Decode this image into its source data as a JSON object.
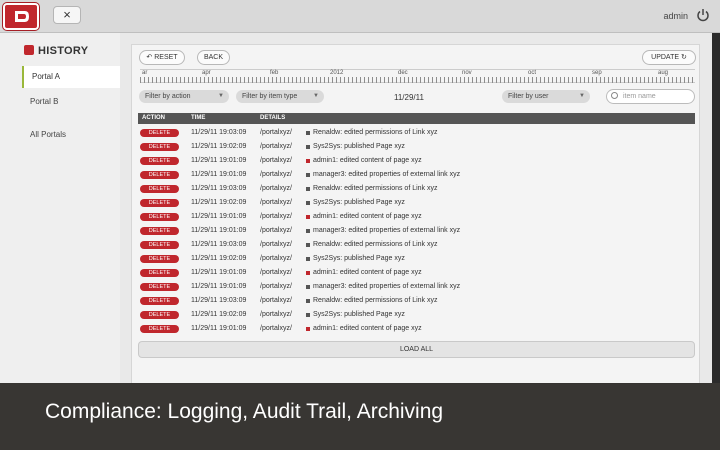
{
  "app": {
    "user": "admin",
    "close_label": "×"
  },
  "sidebar": {
    "title": "HISTORY",
    "items": [
      {
        "label": "Portal A",
        "active": true
      },
      {
        "label": "Portal B",
        "active": false
      },
      {
        "label": "All Portals",
        "active": false
      }
    ]
  },
  "toolbar": {
    "reset_label": "RESET",
    "back_label": "BACK",
    "update_label": "UPDATE"
  },
  "timeline": {
    "labels": [
      "ar",
      "apr",
      "feb",
      "2012",
      "dec",
      "nov",
      "oct",
      "sep",
      "aug"
    ]
  },
  "filters": {
    "action": "Filter by action",
    "item_type": "Filter by item type",
    "date": "11/29/11",
    "user": "Filter by user",
    "search_placeholder": "item name"
  },
  "table": {
    "headers": {
      "action": "ACTION",
      "time": "TIME",
      "details": "DETAILS"
    },
    "rows": [
      {
        "action": "DELETE",
        "time": "11/29/11 19:03:09",
        "site": "/portalxyz/",
        "details": "Renaldw: edited permissions of Link xyz",
        "color": "#555555"
      },
      {
        "action": "DELETE",
        "time": "11/29/11 19:02:09",
        "site": "/portalxyz/",
        "details": "Sys2Sys: published Page xyz",
        "color": "#555555"
      },
      {
        "action": "DELETE",
        "time": "11/29/11 19:01:09",
        "site": "/portalxyz/",
        "details": "admin1: edited content of page xyz",
        "color": "#c0272d"
      },
      {
        "action": "DELETE",
        "time": "11/29/11 19:01:09",
        "site": "/portalxyz/",
        "details": "manager3: edited properties of external link xyz",
        "color": "#555555"
      },
      {
        "action": "DELETE",
        "time": "11/29/11 19:03:09",
        "site": "/portalxyz/",
        "details": "Renaldw: edited permissions of Link xyz",
        "color": "#555555"
      },
      {
        "action": "DELETE",
        "time": "11/29/11 19:02:09",
        "site": "/portalxyz/",
        "details": "Sys2Sys: published Page xyz",
        "color": "#555555"
      },
      {
        "action": "DELETE",
        "time": "11/29/11 19:01:09",
        "site": "/portalxyz/",
        "details": "admin1: edited content of page xyz",
        "color": "#c0272d"
      },
      {
        "action": "DELETE",
        "time": "11/29/11 19:01:09",
        "site": "/portalxyz/",
        "details": "manager3: edited properties of external link xyz",
        "color": "#555555"
      },
      {
        "action": "DELETE",
        "time": "11/29/11 19:03:09",
        "site": "/portalxyz/",
        "details": "Renaldw: edited permissions of Link xyz",
        "color": "#555555"
      },
      {
        "action": "DELETE",
        "time": "11/29/11 19:02:09",
        "site": "/portalxyz/",
        "details": "Sys2Sys: published Page xyz",
        "color": "#555555"
      },
      {
        "action": "DELETE",
        "time": "11/29/11 19:01:09",
        "site": "/portalxyz/",
        "details": "admin1: edited content of page xyz",
        "color": "#c0272d"
      },
      {
        "action": "DELETE",
        "time": "11/29/11 19:01:09",
        "site": "/portalxyz/",
        "details": "manager3: edited properties of external link xyz",
        "color": "#555555"
      },
      {
        "action": "DELETE",
        "time": "11/29/11 19:03:09",
        "site": "/portalxyz/",
        "details": "Renaldw: edited permissions of Link xyz",
        "color": "#555555"
      },
      {
        "action": "DELETE",
        "time": "11/29/11 19:02:09",
        "site": "/portalxyz/",
        "details": "Sys2Sys: published Page xyz",
        "color": "#555555"
      },
      {
        "action": "DELETE",
        "time": "11/29/11 19:01:09",
        "site": "/portalxyz/",
        "details": "admin1: edited content of page xyz",
        "color": "#c0272d"
      }
    ],
    "load_all_label": "LOAD ALL"
  },
  "caption": "Compliance: Logging, Audit Trail, Archiving",
  "colors": {
    "accent": "#c0272d",
    "active_marker": "#9ab83a",
    "caption_bg": "#2a2825"
  }
}
